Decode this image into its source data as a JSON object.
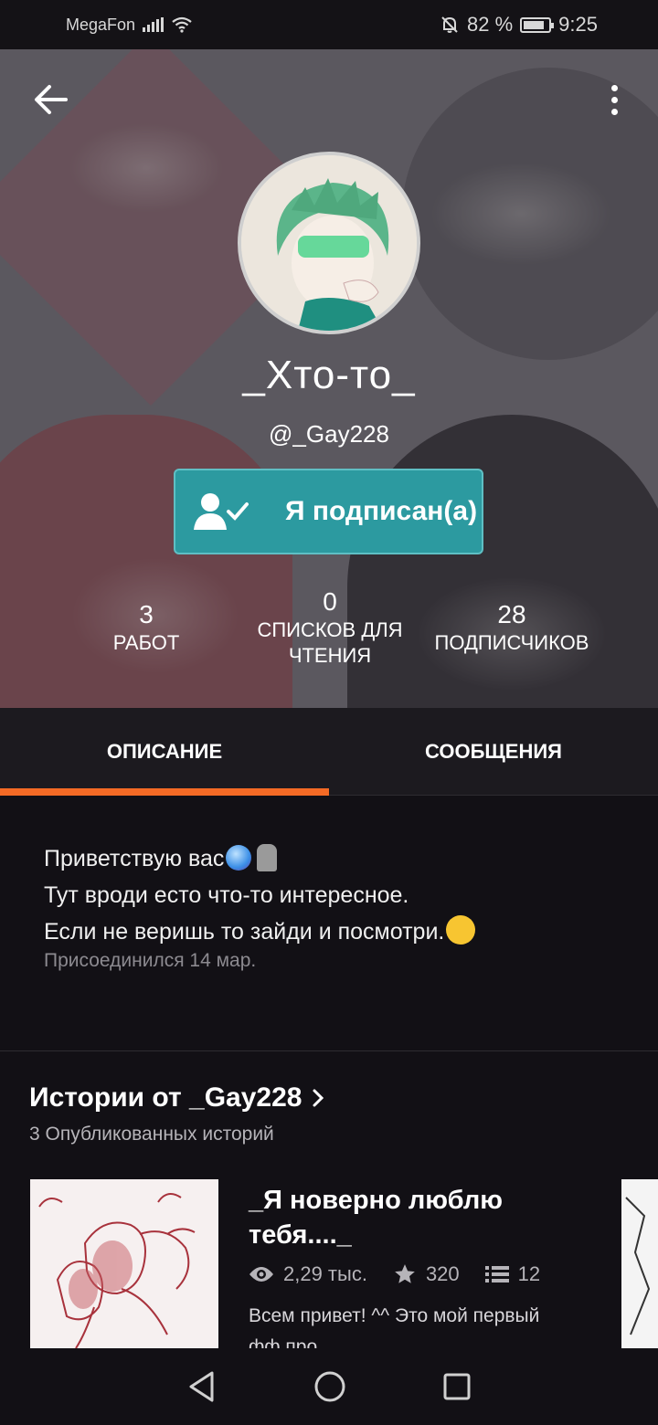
{
  "status_bar": {
    "carrier": "MegaFon",
    "battery": "82 %",
    "time": "9:25"
  },
  "profile": {
    "display_name": "_Хто-то_",
    "username": "@_Gay228",
    "follow_label": "Я подписан(а)",
    "stats": [
      {
        "value": "3",
        "label": "РАБОТ"
      },
      {
        "value": "0",
        "label": "СПИСКОВ ДЛЯ ЧТЕНИЯ"
      },
      {
        "value": "28",
        "label": "ПОДПИСЧИКОВ"
      }
    ]
  },
  "tabs": [
    {
      "label": "ОПИСАНИЕ",
      "active": true
    },
    {
      "label": "СООБЩЕНИЯ",
      "active": false
    }
  ],
  "description": {
    "lines": [
      "Приветствую вас",
      "Тут вроди есто что-то интересное.",
      "Если не веришь то зайди и посмотри."
    ],
    "joined": "Присоединился 14 мар."
  },
  "stories": {
    "title": "Истории от _Gay228",
    "subtitle": "3 Опубликованных историй",
    "items": [
      {
        "title": "_Я новерно люблю тебя...._",
        "views": "2,29 тыс.",
        "votes": "320",
        "parts": "12",
        "description": "Всем привет! ^^ Это мой первый фф про"
      }
    ]
  },
  "colors": {
    "accent": "#f46a25",
    "follow_button": "#2c9aa0",
    "background": "#121015"
  },
  "icons": [
    "back-arrow-icon",
    "more-vertical-icon",
    "user-check-icon",
    "eye-icon",
    "star-icon",
    "list-icon",
    "chevron-right-icon",
    "nav-back-icon",
    "nav-home-icon",
    "nav-recents-icon"
  ]
}
